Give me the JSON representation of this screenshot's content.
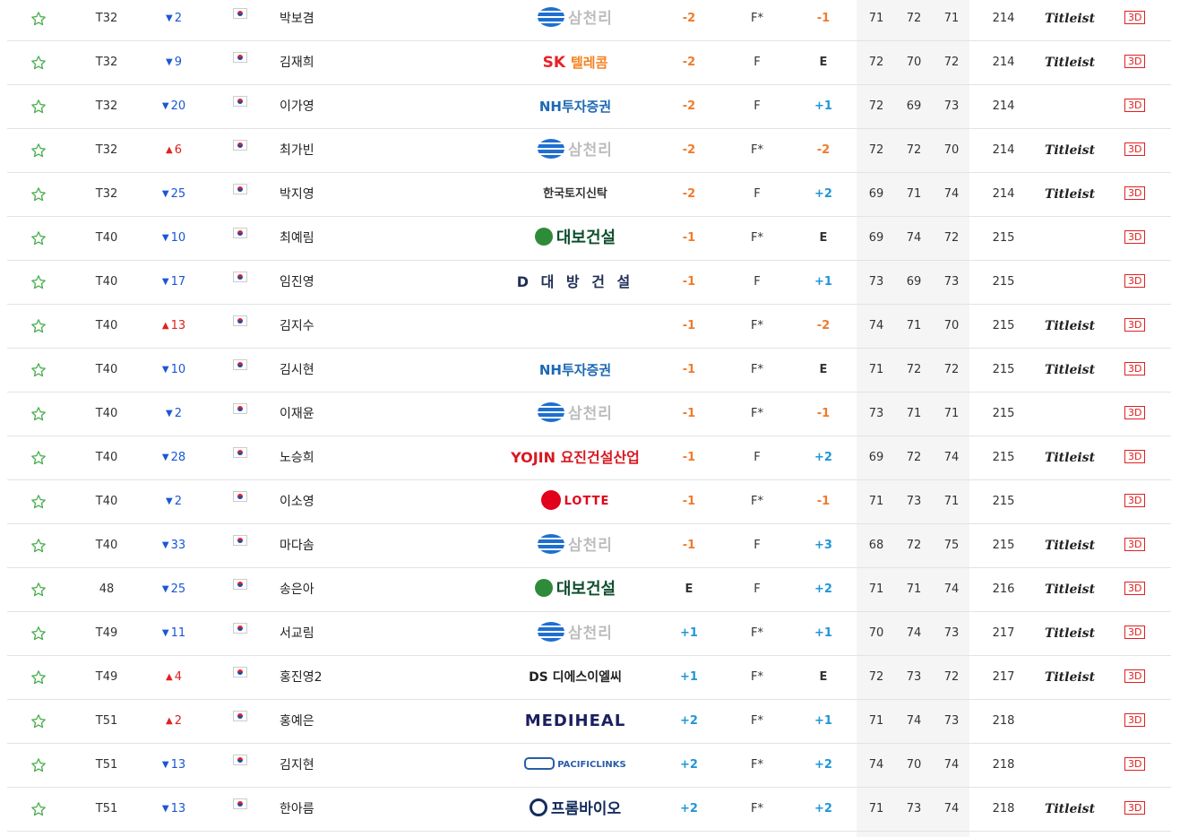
{
  "colors": {
    "under_par": "#f07b2c",
    "over_par": "#2196d8",
    "move_up": "#e02020",
    "move_down": "#1a56d6",
    "favorite_star": "#4caf50",
    "button_3d": "#e02020"
  },
  "rows": [
    {
      "rank": "T32",
      "dir": "down",
      "move": "2",
      "name": "박보겸",
      "sponsor": "삼천리",
      "style": "sam",
      "total": "-2",
      "thru": "F*",
      "today": "-1",
      "r1": "71",
      "r2": "72",
      "r3": "71",
      "tot": "214",
      "brand": "Titleist",
      "btn": "3D"
    },
    {
      "rank": "T32",
      "dir": "down",
      "move": "9",
      "name": "김재희",
      "sponsor": "SK 텔레콤",
      "style": "sk",
      "total": "-2",
      "thru": "F",
      "today": "E",
      "r1": "72",
      "r2": "70",
      "r3": "72",
      "tot": "214",
      "brand": "Titleist",
      "btn": "3D"
    },
    {
      "rank": "T32",
      "dir": "down",
      "move": "20",
      "name": "이가영",
      "sponsor": "NH투자증권",
      "style": "nh",
      "total": "-2",
      "thru": "F",
      "today": "+1",
      "r1": "72",
      "r2": "69",
      "r3": "73",
      "tot": "214",
      "brand": "",
      "btn": "3D"
    },
    {
      "rank": "T32",
      "dir": "up",
      "move": "6",
      "name": "최가빈",
      "sponsor": "삼천리",
      "style": "sam",
      "total": "-2",
      "thru": "F*",
      "today": "-2",
      "r1": "72",
      "r2": "72",
      "r3": "70",
      "tot": "214",
      "brand": "Titleist",
      "btn": "3D"
    },
    {
      "rank": "T32",
      "dir": "down",
      "move": "25",
      "name": "박지영",
      "sponsor": "한국토지신탁",
      "style": "lh",
      "total": "-2",
      "thru": "F",
      "today": "+2",
      "r1": "69",
      "r2": "71",
      "r3": "74",
      "tot": "214",
      "brand": "Titleist",
      "btn": "3D"
    },
    {
      "rank": "T40",
      "dir": "down",
      "move": "10",
      "name": "최예림",
      "sponsor": "대보건설",
      "style": "db",
      "total": "-1",
      "thru": "F*",
      "today": "E",
      "r1": "69",
      "r2": "74",
      "r3": "72",
      "tot": "215",
      "brand": "",
      "btn": "3D"
    },
    {
      "rank": "T40",
      "dir": "down",
      "move": "17",
      "name": "임진영",
      "sponsor": "D 대 방 건 설",
      "style": "dbang",
      "total": "-1",
      "thru": "F",
      "today": "+1",
      "r1": "73",
      "r2": "69",
      "r3": "73",
      "tot": "215",
      "brand": "",
      "btn": "3D"
    },
    {
      "rank": "T40",
      "dir": "up",
      "move": "13",
      "name": "김지수",
      "sponsor": "",
      "style": "none",
      "total": "-1",
      "thru": "F*",
      "today": "-2",
      "r1": "74",
      "r2": "71",
      "r3": "70",
      "tot": "215",
      "brand": "Titleist",
      "btn": "3D"
    },
    {
      "rank": "T40",
      "dir": "down",
      "move": "10",
      "name": "김시현",
      "sponsor": "NH투자증권",
      "style": "nh",
      "total": "-1",
      "thru": "F*",
      "today": "E",
      "r1": "71",
      "r2": "72",
      "r3": "72",
      "tot": "215",
      "brand": "Titleist",
      "btn": "3D"
    },
    {
      "rank": "T40",
      "dir": "down",
      "move": "2",
      "name": "이재윤",
      "sponsor": "삼천리",
      "style": "sam",
      "total": "-1",
      "thru": "F*",
      "today": "-1",
      "r1": "73",
      "r2": "71",
      "r3": "71",
      "tot": "215",
      "brand": "",
      "btn": "3D"
    },
    {
      "rank": "T40",
      "dir": "down",
      "move": "28",
      "name": "노승희",
      "sponsor": "YOJIN 요진건설산업",
      "style": "yojin",
      "total": "-1",
      "thru": "F",
      "today": "+2",
      "r1": "69",
      "r2": "72",
      "r3": "74",
      "tot": "215",
      "brand": "Titleist",
      "btn": "3D"
    },
    {
      "rank": "T40",
      "dir": "down",
      "move": "2",
      "name": "이소영",
      "sponsor": "LOTTE",
      "style": "lotte",
      "total": "-1",
      "thru": "F*",
      "today": "-1",
      "r1": "71",
      "r2": "73",
      "r3": "71",
      "tot": "215",
      "brand": "",
      "btn": "3D"
    },
    {
      "rank": "T40",
      "dir": "down",
      "move": "33",
      "name": "마다솜",
      "sponsor": "삼천리",
      "style": "sam",
      "total": "-1",
      "thru": "F",
      "today": "+3",
      "r1": "68",
      "r2": "72",
      "r3": "75",
      "tot": "215",
      "brand": "Titleist",
      "btn": "3D"
    },
    {
      "rank": "48",
      "dir": "down",
      "move": "25",
      "name": "송은아",
      "sponsor": "대보건설",
      "style": "db",
      "total": "E",
      "thru": "F",
      "today": "+2",
      "r1": "71",
      "r2": "71",
      "r3": "74",
      "tot": "216",
      "brand": "Titleist",
      "btn": "3D"
    },
    {
      "rank": "T49",
      "dir": "down",
      "move": "11",
      "name": "서교림",
      "sponsor": "삼천리",
      "style": "sam",
      "total": "+1",
      "thru": "F*",
      "today": "+1",
      "r1": "70",
      "r2": "74",
      "r3": "73",
      "tot": "217",
      "brand": "Titleist",
      "btn": "3D"
    },
    {
      "rank": "T49",
      "dir": "up",
      "move": "4",
      "name": "홍진영2",
      "sponsor": "DS 디에스이엘씨",
      "style": "ds",
      "total": "+1",
      "thru": "F*",
      "today": "E",
      "r1": "72",
      "r2": "73",
      "r3": "72",
      "tot": "217",
      "brand": "Titleist",
      "btn": "3D"
    },
    {
      "rank": "T51",
      "dir": "up",
      "move": "2",
      "name": "홍예은",
      "sponsor": "MEDIHEAL",
      "style": "medi",
      "total": "+2",
      "thru": "F*",
      "today": "+1",
      "r1": "71",
      "r2": "74",
      "r3": "73",
      "tot": "218",
      "brand": "",
      "btn": "3D"
    },
    {
      "rank": "T51",
      "dir": "down",
      "move": "13",
      "name": "김지현",
      "sponsor": "PACIFICLINKS",
      "style": "pac",
      "total": "+2",
      "thru": "F*",
      "today": "+2",
      "r1": "74",
      "r2": "70",
      "r3": "74",
      "tot": "218",
      "brand": "",
      "btn": "3D"
    },
    {
      "rank": "T51",
      "dir": "down",
      "move": "13",
      "name": "한아름",
      "sponsor": "프롬바이오",
      "style": "prom",
      "total": "+2",
      "thru": "F*",
      "today": "+2",
      "r1": "71",
      "r2": "73",
      "r3": "74",
      "tot": "218",
      "brand": "Titleist",
      "btn": "3D"
    }
  ]
}
